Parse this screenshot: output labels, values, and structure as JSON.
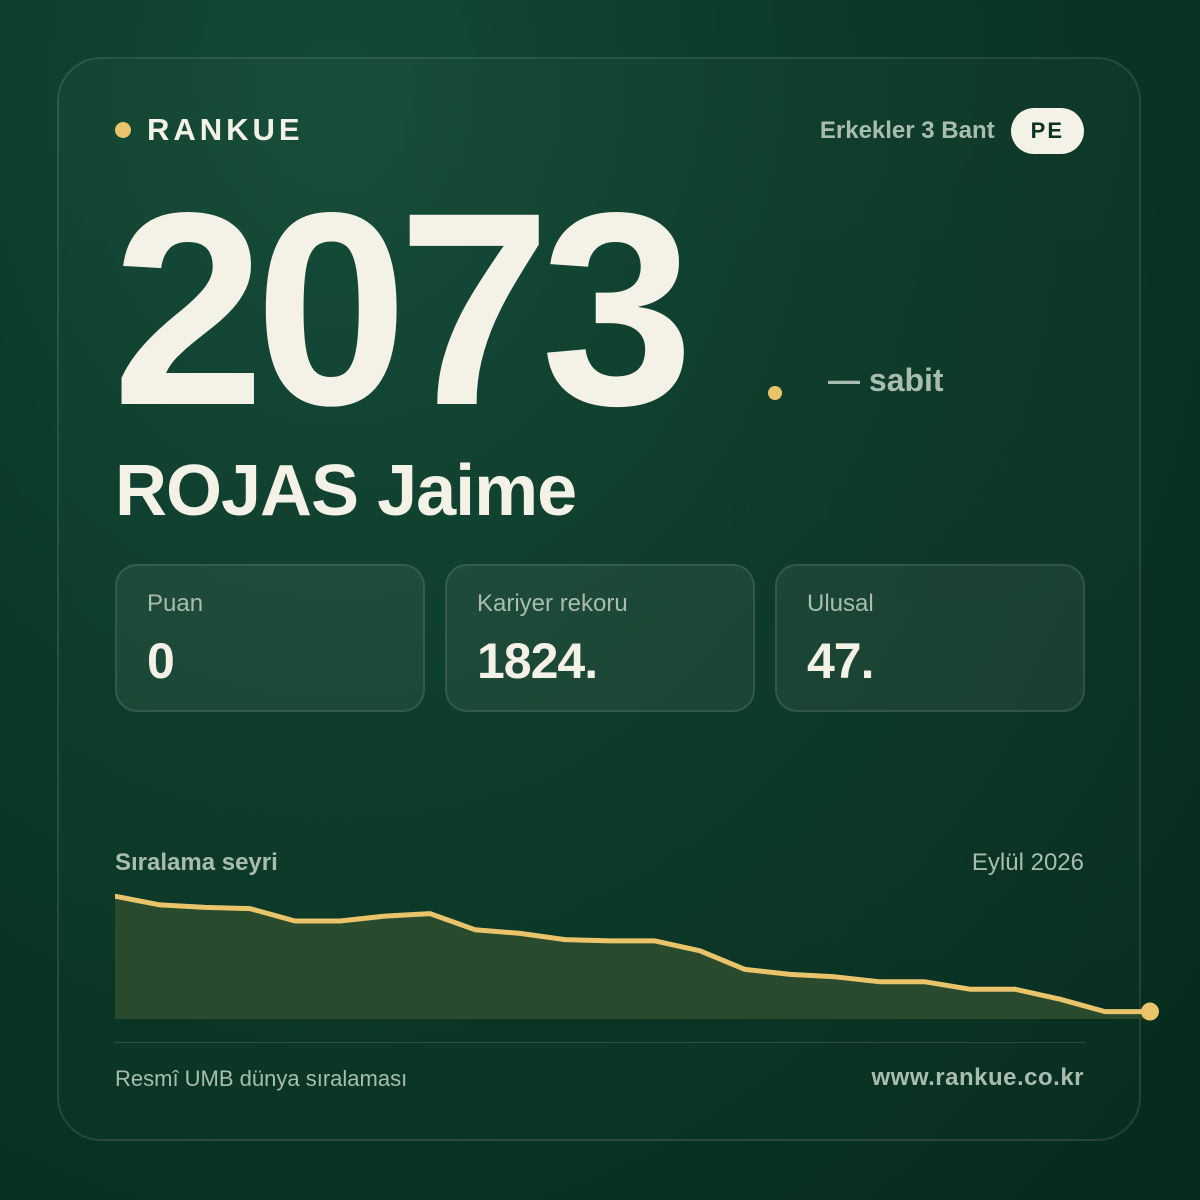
{
  "brand": {
    "name": "RANKUE",
    "accent_color": "#e9c46a"
  },
  "category": {
    "label": "Erkekler 3 Bant",
    "country_code": "PE"
  },
  "rank": {
    "value": "2073",
    "trend": "— sabit"
  },
  "player": {
    "name": "ROJAS Jaime"
  },
  "stats": [
    {
      "label": "Puan",
      "value": "0"
    },
    {
      "label": "Kariyer rekoru",
      "value": "1824."
    },
    {
      "label": "Ulusal",
      "value": "47."
    }
  ],
  "chart_header": {
    "title": "Sıralama seyri",
    "date": "Eylül 2026"
  },
  "chart_data": {
    "type": "area",
    "title": "Sıralama seyri",
    "xlabel": "",
    "ylabel": "",
    "values": [
      0.99,
      0.92,
      0.9,
      0.89,
      0.79,
      0.79,
      0.83,
      0.85,
      0.72,
      0.69,
      0.64,
      0.63,
      0.63,
      0.55,
      0.4,
      0.36,
      0.34,
      0.3,
      0.3,
      0.24,
      0.24,
      0.16,
      0.06,
      0.06
    ],
    "ylim": [
      0,
      1
    ],
    "line_color": "#e9c46a",
    "fill_color": "#2a4a2e",
    "grid": false,
    "legend": false,
    "end_marker": true
  },
  "footer": {
    "source": "Resmî UMB dünya sıralaması",
    "url": "www.rankue.co.kr"
  }
}
